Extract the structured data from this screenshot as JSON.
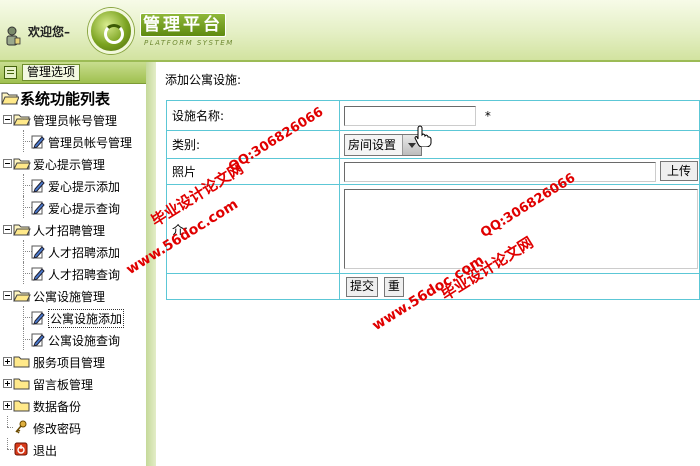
{
  "header": {
    "welcome_text": "欢迎您–",
    "brand_title": "管理平台",
    "brand_subtitle": "PLATFORM SYSTEM"
  },
  "sidebar": {
    "options_label": "管理选项",
    "root_label": "系统功能列表",
    "groups": [
      {
        "label": "管理员帐号管理",
        "expanded": true,
        "items": [
          {
            "label": "管理员帐号管理"
          }
        ]
      },
      {
        "label": "爱心提示管理",
        "expanded": true,
        "items": [
          {
            "label": "爱心提示添加"
          },
          {
            "label": "爱心提示查询"
          }
        ]
      },
      {
        "label": "人才招聘管理",
        "expanded": true,
        "items": [
          {
            "label": "人才招聘添加"
          },
          {
            "label": "人才招聘查询"
          }
        ]
      },
      {
        "label": "公寓设施管理",
        "expanded": true,
        "items": [
          {
            "label": "公寓设施添加",
            "active": true
          },
          {
            "label": "公寓设施查询"
          }
        ]
      },
      {
        "label": "服务项目管理",
        "expanded": false
      },
      {
        "label": "留言板管理",
        "expanded": false
      },
      {
        "label": "数据备份",
        "expanded": false
      }
    ],
    "tools": [
      {
        "label": "修改密码",
        "icon": "key-icon"
      },
      {
        "label": "退出",
        "icon": "exit-icon"
      }
    ]
  },
  "main": {
    "page_title": "添加公寓设施:",
    "form": {
      "name_label": "设施名称:",
      "name_value": "",
      "required_mark": "*",
      "category_label": "类别:",
      "category_selected": "房间设置",
      "photo_label": "照片",
      "photo_value": "",
      "upload_label": "上传",
      "intro_label": "介:",
      "intro_value": "",
      "submit_label": "提交",
      "reset_label": "重"
    }
  },
  "watermarks": {
    "qq": "QQ:306826066",
    "site": "www.56doc.com",
    "brand": "毕业设计论文网"
  },
  "colors": {
    "accent_green": "#7ba321",
    "table_border": "#5cc7d6",
    "watermark_red": "#e00000"
  }
}
